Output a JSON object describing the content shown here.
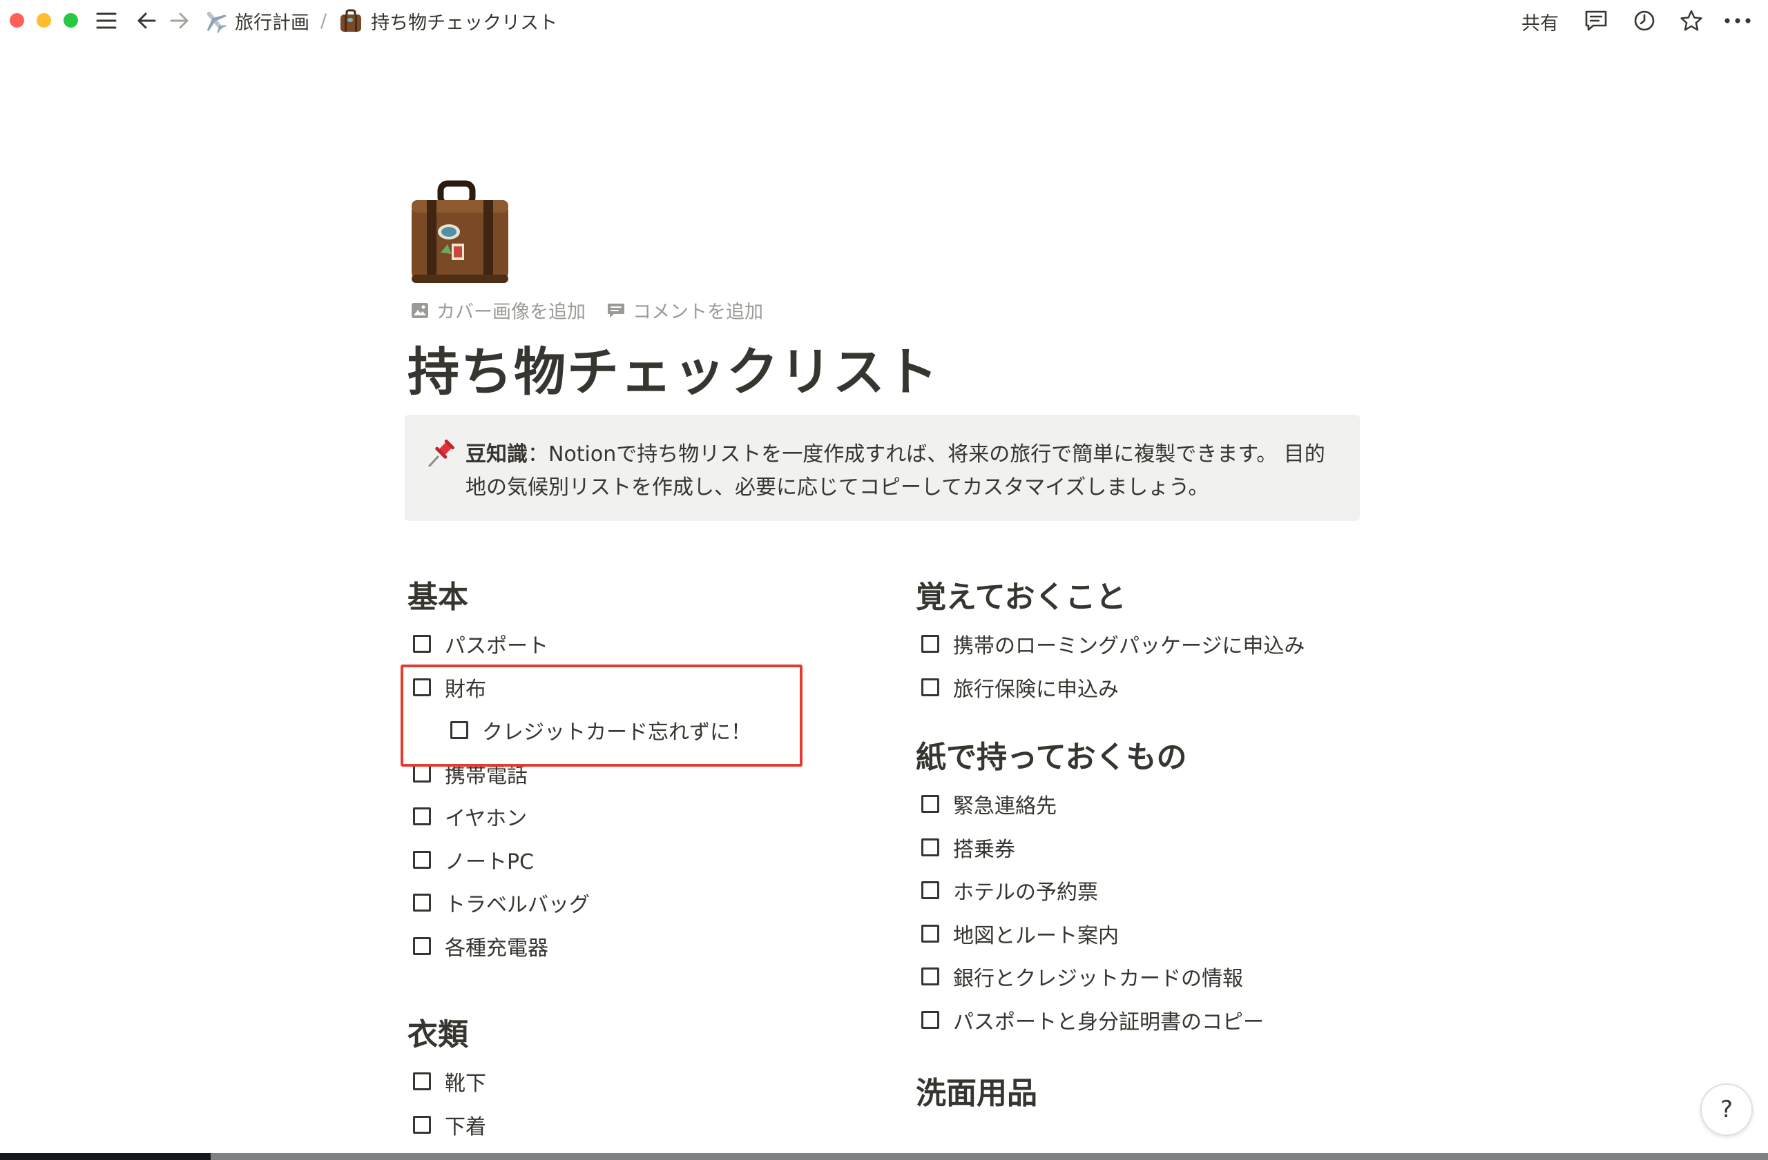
{
  "breadcrumb": {
    "items": [
      {
        "label": "旅行計画",
        "icon": "airplane-icon"
      },
      {
        "label": "持ち物チェックリスト",
        "icon": "luggage-icon"
      }
    ],
    "separator": "/"
  },
  "topbar": {
    "share_label": "共有",
    "icons": [
      "menu-icon",
      "back-arrow-icon",
      "forward-arrow-icon",
      "comments-icon",
      "history-icon",
      "favorite-star-icon",
      "more-icon"
    ]
  },
  "page": {
    "icon": "luggage-icon",
    "actions": {
      "add_cover": "カバー画像を追加",
      "add_comment": "コメントを追加"
    },
    "title": "持ち物チェックリスト"
  },
  "callout": {
    "icon": "pushpin-icon",
    "label": "豆知識",
    "separator": "：",
    "text": "Notionで持ち物リストを一度作成すれば、将来の旅行で簡単に複製できます。 目的地の気候別リストを作成し、必要に応じてコピーしてカスタマイズしましょう。"
  },
  "left_column": {
    "basics": {
      "heading": "基本",
      "items": [
        {
          "label": "パスポート",
          "checked": false
        },
        {
          "label": "財布",
          "checked": false
        },
        {
          "label": "クレジットカード忘れずに！",
          "checked": false,
          "indent": true
        },
        {
          "label": "携帯電話",
          "checked": false
        },
        {
          "label": "イヤホン",
          "checked": false
        },
        {
          "label": "ノートPC",
          "checked": false
        },
        {
          "label": "トラベルバッグ",
          "checked": false
        },
        {
          "label": "各種充電器",
          "checked": false
        }
      ]
    },
    "clothes": {
      "heading": "衣類",
      "items": [
        {
          "label": "靴下",
          "checked": false
        },
        {
          "label": "下着",
          "checked": false
        }
      ]
    }
  },
  "right_column": {
    "remember": {
      "heading": "覚えておくこと",
      "items": [
        {
          "label": "携帯のローミングパッケージに申込み",
          "checked": false
        },
        {
          "label": "旅行保険に申込み",
          "checked": false
        }
      ]
    },
    "paper": {
      "heading": "紙で持っておくもの",
      "items": [
        {
          "label": "緊急連絡先",
          "checked": false
        },
        {
          "label": "搭乗券",
          "checked": false
        },
        {
          "label": "ホテルの予約票",
          "checked": false
        },
        {
          "label": "地図とルート案内",
          "checked": false
        },
        {
          "label": "銀行とクレジットカードの情報",
          "checked": false
        },
        {
          "label": "パスポートと身分証明書のコピー",
          "checked": false
        }
      ]
    },
    "toiletries": {
      "heading": "洗面用品"
    }
  },
  "help_label": "?",
  "colors": {
    "text": "#37352f",
    "muted": "#9b9a97",
    "callout_bg": "#f1f1ef",
    "highlight_border": "#e33b2e"
  }
}
